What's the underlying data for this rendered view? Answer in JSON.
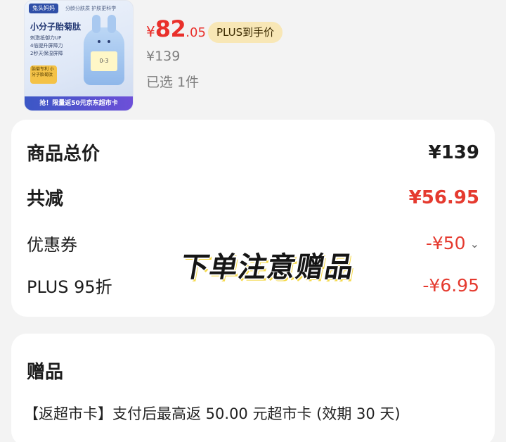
{
  "product": {
    "image": {
      "tag": "兔头妈妈",
      "tagline": "分龄分肤质 护肤更科学",
      "title": "小分子胎菊肽",
      "bullets": [
        "刺激抵御力UP",
        "4倍提升屏障力",
        "2秒天保湿屏障"
      ],
      "jar_label": "0-3",
      "sticker": "胎菊专利 小分子胎菊肽",
      "banner": "抢！限量返50元京东超市卡"
    },
    "price_symbol": "¥",
    "price_integer": "82",
    "price_decimal": ".05",
    "plus_badge": "PLUS到手价",
    "original_price": "¥139",
    "selected_count": "已选 1件"
  },
  "summary": {
    "rows": [
      {
        "label": "商品总价",
        "value": "¥139"
      },
      {
        "label": "共减",
        "value": "¥56.95"
      },
      {
        "label": "优惠券",
        "value": "-¥50"
      },
      {
        "label": "PLUS 95折",
        "value": "-¥6.95"
      }
    ],
    "coupon_chevron": "⌄"
  },
  "overlay_text": "下单注意赠品",
  "gift": {
    "title": "赠品",
    "line": "【返超市卡】支付后最高返 50.00 元超市卡 (效期 30 天)"
  },
  "colors": {
    "accent_red": "#e53a2f",
    "plus_badge_bg": "#f8e7b6"
  }
}
